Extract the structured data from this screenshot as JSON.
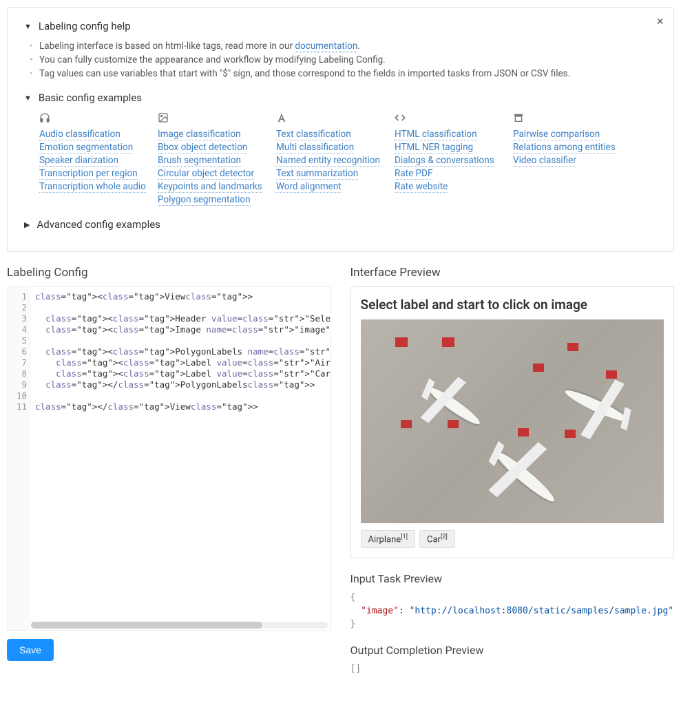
{
  "help": {
    "title": "Labeling config help",
    "bullets": {
      "b1_pre": "Labeling interface is based on html-like tags, read more in our ",
      "b1_link": "documentation",
      "b1_post": ".",
      "b2": "You can fully customize the appearance and workflow by modifying Labeling Config.",
      "b3": "Tag values can use variables that start with \"$\" sign, and those correspond to the fields in imported tasks from JSON or CSV files."
    },
    "basic_title": "Basic config examples",
    "adv_title": "Advanced config examples",
    "columns": [
      {
        "icon": "headphones-icon",
        "links": [
          "Audio classification",
          "Emotion segmentation",
          "Speaker diarization",
          "Transcription per region",
          "Transcription whole audio"
        ]
      },
      {
        "icon": "image-icon",
        "links": [
          "Image classification",
          "Bbox object detection",
          "Brush segmentation",
          "Circular object detector",
          "Keypoints and landmarks",
          "Polygon segmentation"
        ]
      },
      {
        "icon": "font-icon",
        "links": [
          "Text classification",
          "Multi classification",
          "Named entity recognition",
          "Text summarization",
          "Word alignment"
        ]
      },
      {
        "icon": "code-icon",
        "links": [
          "HTML classification",
          "HTML NER tagging",
          "Dialogs & conversations",
          "Rate PDF",
          "Rate website"
        ]
      },
      {
        "icon": "archive-icon",
        "links": [
          "Pairwise comparison",
          "Relations among entities",
          "Video classifier"
        ]
      }
    ]
  },
  "labeling_config_title": "Labeling Config",
  "interface_preview_title": "Interface Preview",
  "editor": {
    "line_count": 11,
    "lines_plain": "<View>\n\n  <Header value=\"Select label and start to click on image\"></Header>\n  <Image name=\"image\" value=\"$image\"></Image>\n\n  <PolygonLabels name=\"label\" toName=\"image\" strokeWidth=\"3\" pointS\n    <Label value=\"Airplane\" background=\"red\"></Label>\n    <Label value=\"Car\" background=\"blue\"></Label>\n  </PolygonLabels>\n\n</View>"
  },
  "save_label": "Save",
  "preview": {
    "header": "Select label and start to click on image",
    "labels": [
      {
        "name": "Airplane",
        "key": "[1]"
      },
      {
        "name": "Car",
        "key": "[2]"
      }
    ]
  },
  "input_task": {
    "title": "Input Task Preview",
    "open": "{",
    "key": "\"image\"",
    "colon": ": ",
    "value": "\"http://localhost:8080/static/samples/sample.jpg\"",
    "close": "}"
  },
  "output": {
    "title": "Output Completion Preview",
    "body": "[]"
  }
}
